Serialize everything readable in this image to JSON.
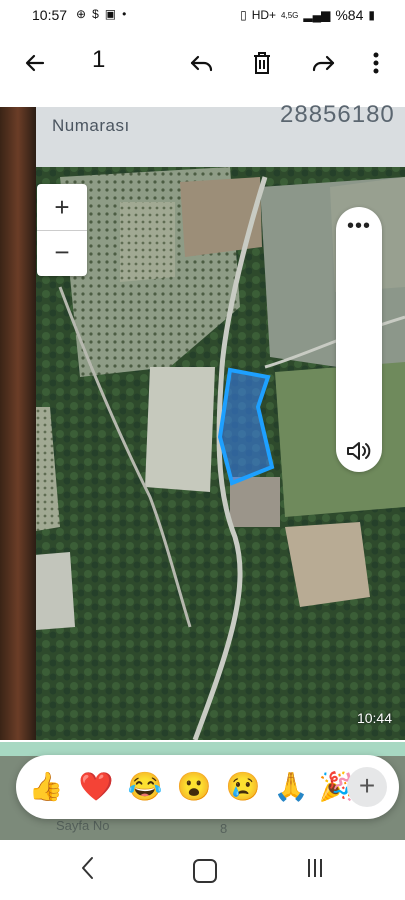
{
  "status_bar": {
    "time": "10:57",
    "network": "4,5G",
    "battery": "%84"
  },
  "viewer": {
    "count": "1",
    "icons": [
      "back-arrow-icon",
      "reply-icon",
      "delete-icon",
      "forward-icon",
      "more-vert-icon"
    ]
  },
  "photo": {
    "doc_label": "Numarası",
    "doc_number": "28856180",
    "zoom_in": "+",
    "zoom_out": "−",
    "video_menu": "•••",
    "timestamp": "10:44"
  },
  "reactions": {
    "items": [
      "👍",
      "❤️",
      "😂",
      "😮",
      "😢",
      "🙏",
      "🎉"
    ],
    "add": "+"
  },
  "background_doc": {
    "sayfa_label": "Sayfa No",
    "sayfa_value": "8"
  },
  "colors": {
    "parcel_fill": "#3b82f6",
    "parcel_stroke": "#1ea0ff",
    "teal_band": "#a7d8c2"
  }
}
